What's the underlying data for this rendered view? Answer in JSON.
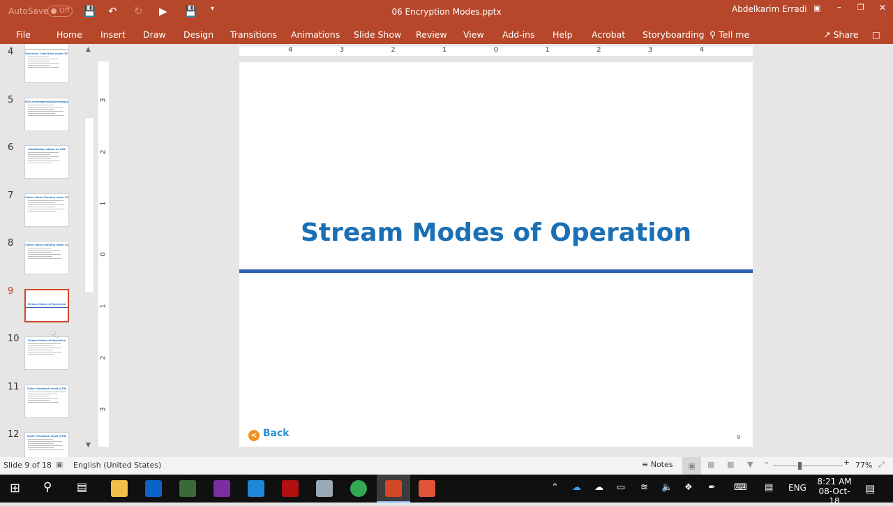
{
  "app": {
    "autosave_label": "AutoSave",
    "autosave_state": "Off",
    "file_title": "06 Encryption Modes.pptx",
    "user": "Abdelkarim Erradi",
    "accent": "#b7472a"
  },
  "ribbon": {
    "tabs": [
      "File",
      "Home",
      "Insert",
      "Draw",
      "Design",
      "Transitions",
      "Animations",
      "Slide Show",
      "Review",
      "View",
      "Add-ins",
      "Help",
      "Acrobat",
      "Storyboarding"
    ],
    "tell_me": "Tell me",
    "share": "Share"
  },
  "thumbnails": [
    {
      "num": "4",
      "title": "Electronic Code Book mode (ECB)"
    },
    {
      "num": "5",
      "title": "ECB advantages/disadvantages"
    },
    {
      "num": "6",
      "title": "Substitution Attack on ECB"
    },
    {
      "num": "7",
      "title": "Cipher Block Chaining mode (CBC)"
    },
    {
      "num": "8",
      "title": "Cipher Block Chaining mode (CBC)"
    },
    {
      "num": "9",
      "title": "Stream Modes of Operation",
      "selected": true
    },
    {
      "num": "10",
      "title": "Stream Modes of Operation"
    },
    {
      "num": "11",
      "title": "Cipher Feedback mode (CFB)"
    },
    {
      "num": "12",
      "title": "Cipher Feedback mode (CFB)"
    }
  ],
  "rulers": {
    "horizontal": [
      "4",
      "3",
      "2",
      "1",
      "0",
      "1",
      "2",
      "3",
      "4"
    ],
    "vertical": [
      "3",
      "2",
      "1",
      "0",
      "1",
      "2",
      "3"
    ]
  },
  "slide": {
    "title": "Stream Modes of Operation",
    "back_label": "Back",
    "page_number": "9",
    "title_color": "#1a6fb5",
    "rule_color": "#2f5fb3"
  },
  "status": {
    "slide_info": "Slide 9 of 18",
    "language": "English (United States)",
    "notes": "Notes",
    "zoom": "77%",
    "zoom_level_percent": 77
  },
  "taskbar": {
    "time": "8:21 AM",
    "date": "08-Oct-18",
    "lang": "ENG"
  }
}
